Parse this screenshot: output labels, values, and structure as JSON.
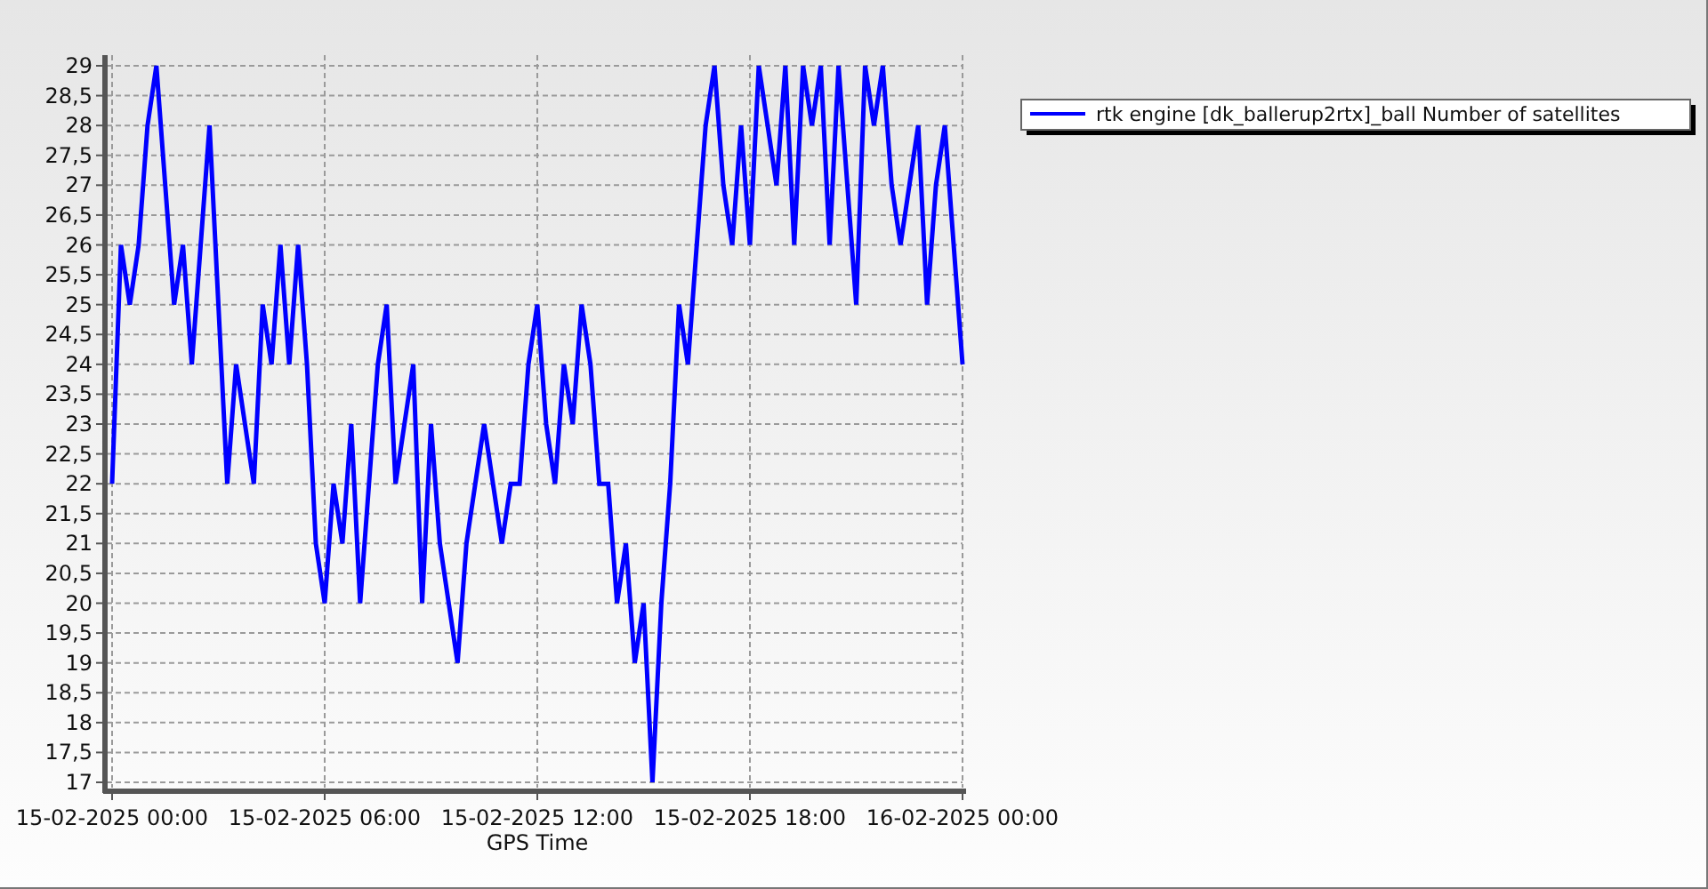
{
  "chart": {
    "chart_data": {
      "type": "line",
      "xlabel": "GPS Time",
      "categories": [
        "15-02-2025 00:00",
        null,
        null,
        null,
        null,
        null,
        null,
        null,
        null,
        null,
        null,
        null,
        null,
        null,
        null,
        null,
        null,
        null,
        null,
        null,
        null,
        null,
        null,
        null,
        "15-02-2025 06:00",
        null,
        null,
        null,
        null,
        null,
        null,
        null,
        null,
        null,
        null,
        null,
        null,
        null,
        null,
        null,
        null,
        null,
        null,
        null,
        null,
        null,
        null,
        null,
        "15-02-2025 12:00",
        null,
        null,
        null,
        null,
        null,
        null,
        null,
        null,
        null,
        null,
        null,
        null,
        null,
        null,
        null,
        null,
        null,
        null,
        null,
        null,
        null,
        null,
        null,
        "15-02-2025 18:00",
        null,
        null,
        null,
        null,
        null,
        null,
        null,
        null,
        null,
        null,
        null,
        null,
        null,
        null,
        null,
        null,
        null,
        null,
        null,
        null,
        null,
        null,
        null,
        "16-02-2025 00:00"
      ],
      "series": [
        {
          "name": "rtk engine [dk_ballerup2rtx]_ball Number of satellites",
          "color": "#0000ff",
          "values": [
            22,
            26,
            25,
            26,
            28,
            29,
            27,
            25,
            26,
            24,
            26,
            28,
            25,
            22,
            24,
            23,
            22,
            25,
            24,
            26,
            24,
            26,
            24,
            21,
            20,
            22,
            21,
            23,
            20,
            22,
            24,
            25,
            22,
            23,
            24,
            20,
            23,
            21,
            20,
            19,
            21,
            22,
            23,
            22,
            21,
            22,
            22,
            24,
            25,
            23,
            22,
            24,
            23,
            25,
            24,
            22,
            22,
            20,
            21,
            19,
            20,
            17,
            20,
            22,
            25,
            24,
            26,
            28,
            29,
            27,
            26,
            28,
            26,
            29,
            28,
            27,
            29,
            26,
            29,
            28,
            29,
            26,
            29,
            27,
            25,
            29,
            28,
            29,
            27,
            26,
            27,
            28,
            25,
            27,
            28,
            26,
            24
          ]
        }
      ],
      "ylim": [
        17,
        29
      ],
      "grid": true,
      "yticks": [
        17,
        {
          "value": 17.5,
          "label": "17,5"
        },
        18,
        {
          "value": 18.5,
          "label": "18,5"
        },
        19,
        {
          "value": 19.5,
          "label": "19,5"
        },
        20,
        {
          "value": 20.5,
          "label": "20,5"
        },
        21,
        {
          "value": 21.5,
          "label": "21,5"
        },
        22,
        {
          "value": 22.5,
          "label": "22,5"
        },
        23,
        {
          "value": 23.5,
          "label": "23,5"
        },
        24,
        {
          "value": 24.5,
          "label": "24,5"
        },
        25,
        {
          "value": 25.5,
          "label": "25,5"
        },
        26,
        {
          "value": 26.5,
          "label": "26,5"
        },
        27,
        {
          "value": 27.5,
          "label": "27,5"
        },
        28,
        {
          "value": 28.5,
          "label": "28,5"
        },
        29
      ]
    }
  }
}
